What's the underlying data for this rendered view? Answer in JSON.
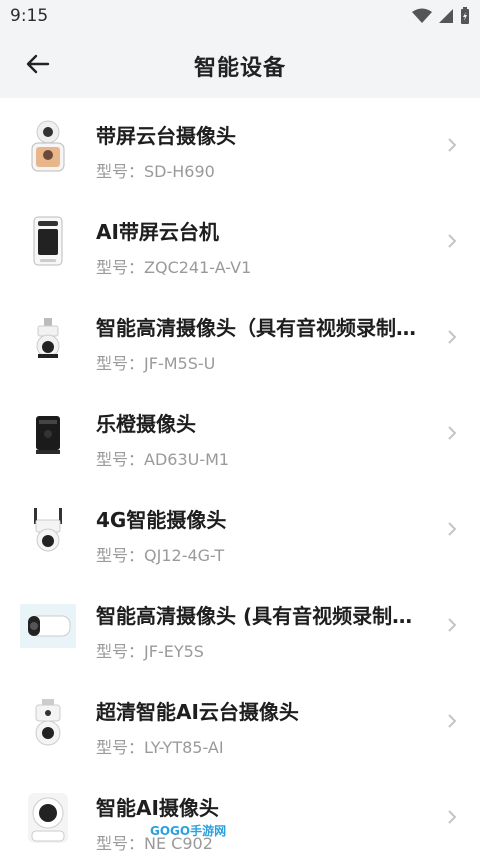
{
  "status_bar": {
    "time": "9:15"
  },
  "header": {
    "title": "智能设备"
  },
  "model_prefix": "型号：",
  "devices": [
    {
      "name": "带屏云台摄像头",
      "model": "SD-H690",
      "icon": "screen-ptz-camera-icon"
    },
    {
      "name": "AI带屏云台机",
      "model": "ZQC241-A-V1",
      "icon": "ai-screen-ptz-icon"
    },
    {
      "name": "智能高清摄像头（具有音视频录制功能）",
      "model": "JF-M5S-U",
      "icon": "dome-camera-icon"
    },
    {
      "name": "乐橙摄像头",
      "model": "AD63U-M1",
      "icon": "lechange-camera-icon"
    },
    {
      "name": "4G智能摄像头",
      "model": "QJ12-4G-T",
      "icon": "4g-camera-icon"
    },
    {
      "name": "智能高清摄像头 (具有音视频录制功能)",
      "model": "JF-EY5S",
      "icon": "bullet-camera-icon"
    },
    {
      "name": "超清智能AI云台摄像头",
      "model": "LY-YT85-AI",
      "icon": "ai-ptz-camera-icon"
    },
    {
      "name": "智能AI摄像头",
      "model": "NE C902",
      "icon": "ai-camera-icon"
    }
  ],
  "watermark": "GOGO手游网",
  "colors": {
    "header_bg": "#f3f4f6",
    "text": "#1e1e1e",
    "secondary": "#9a9a9a",
    "chevron": "#c4c4c4"
  }
}
